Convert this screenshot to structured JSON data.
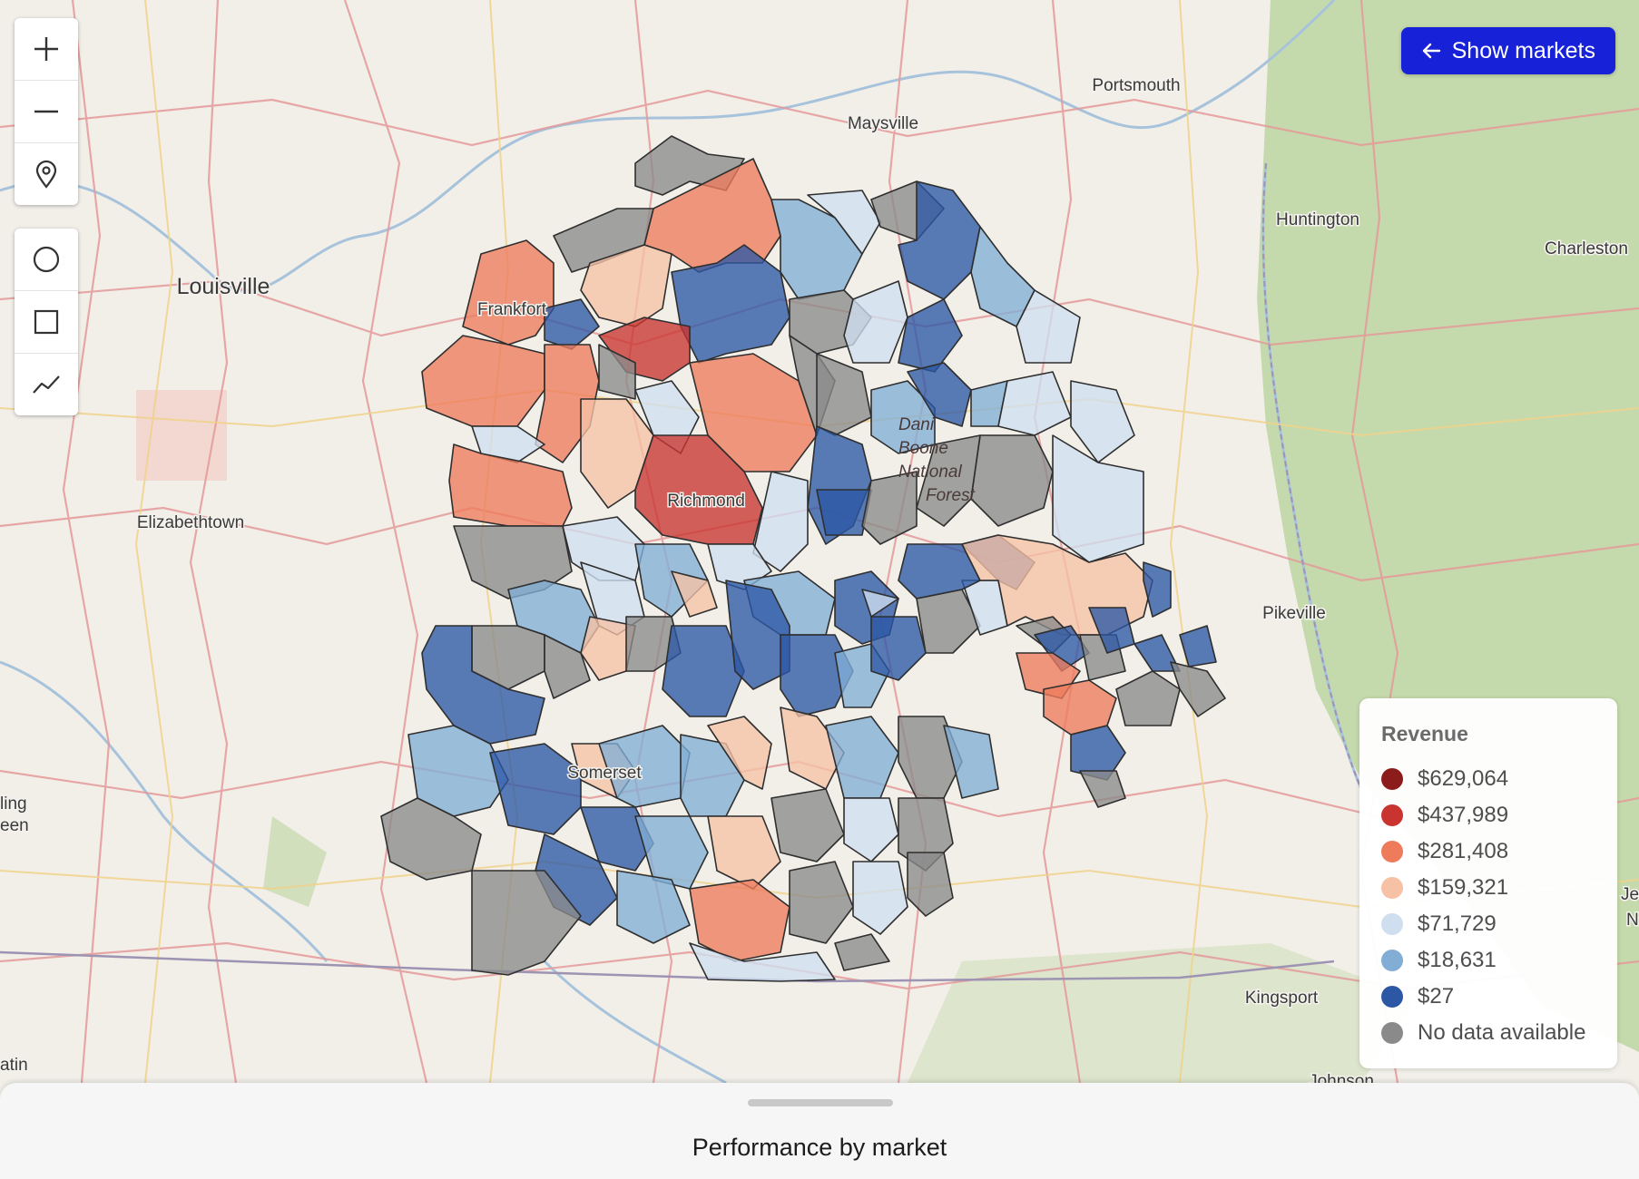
{
  "cities": [
    {
      "name": "Louisville",
      "type": "major"
    },
    {
      "name": "Frankfort",
      "type": "minor"
    },
    {
      "name": "Elizabethtown",
      "type": "minor"
    },
    {
      "name": "Maysville",
      "type": "minor"
    },
    {
      "name": "Portsmouth",
      "type": "minor"
    },
    {
      "name": "Huntington",
      "type": "minor"
    },
    {
      "name": "Charleston",
      "type": "minor"
    },
    {
      "name": "Richmond",
      "type": "minor"
    },
    {
      "name": "Somerset",
      "type": "minor"
    },
    {
      "name": "Pikeville",
      "type": "minor"
    },
    {
      "name": "Kingsport",
      "type": "minor"
    },
    {
      "name": "Johnson",
      "type": "minor"
    },
    {
      "name": "ling",
      "type": "minor"
    },
    {
      "name": "een",
      "type": "minor"
    },
    {
      "name": "atin",
      "type": "minor"
    },
    {
      "name": "Je",
      "type": "minor"
    },
    {
      "name": "N",
      "type": "minor"
    }
  ],
  "park_label": [
    "Dani",
    "Boone",
    "National",
    "Forest"
  ],
  "controls": {
    "zoom": [
      {
        "name": "zoom-in-button",
        "icon": "plus-icon"
      },
      {
        "name": "zoom-out-button",
        "icon": "minus-icon"
      },
      {
        "name": "locate-button",
        "icon": "location-pin-icon"
      }
    ],
    "draw": [
      {
        "name": "draw-circle-button",
        "icon": "circle-icon"
      },
      {
        "name": "draw-rectangle-button",
        "icon": "square-icon"
      },
      {
        "name": "draw-line-button",
        "icon": "polyline-icon"
      }
    ]
  },
  "show_markets": {
    "label": "Show markets",
    "icon": "arrow-left-icon",
    "color": "#1621d8"
  },
  "legend": {
    "title": "Revenue",
    "items": [
      {
        "label": "$629,064",
        "color": "#8c1c1c"
      },
      {
        "label": "$437,989",
        "color": "#c93431"
      },
      {
        "label": "$281,408",
        "color": "#ee7b5c"
      },
      {
        "label": "$159,321",
        "color": "#f6c1a5"
      },
      {
        "label": "$71,729",
        "color": "#cfdff0"
      },
      {
        "label": "$18,631",
        "color": "#82aed6"
      },
      {
        "label": "$27",
        "color": "#2c57a5"
      },
      {
        "label": "No data available",
        "color": "#8a8a8a"
      }
    ]
  },
  "bottom_sheet": {
    "title": "Performance by market"
  }
}
